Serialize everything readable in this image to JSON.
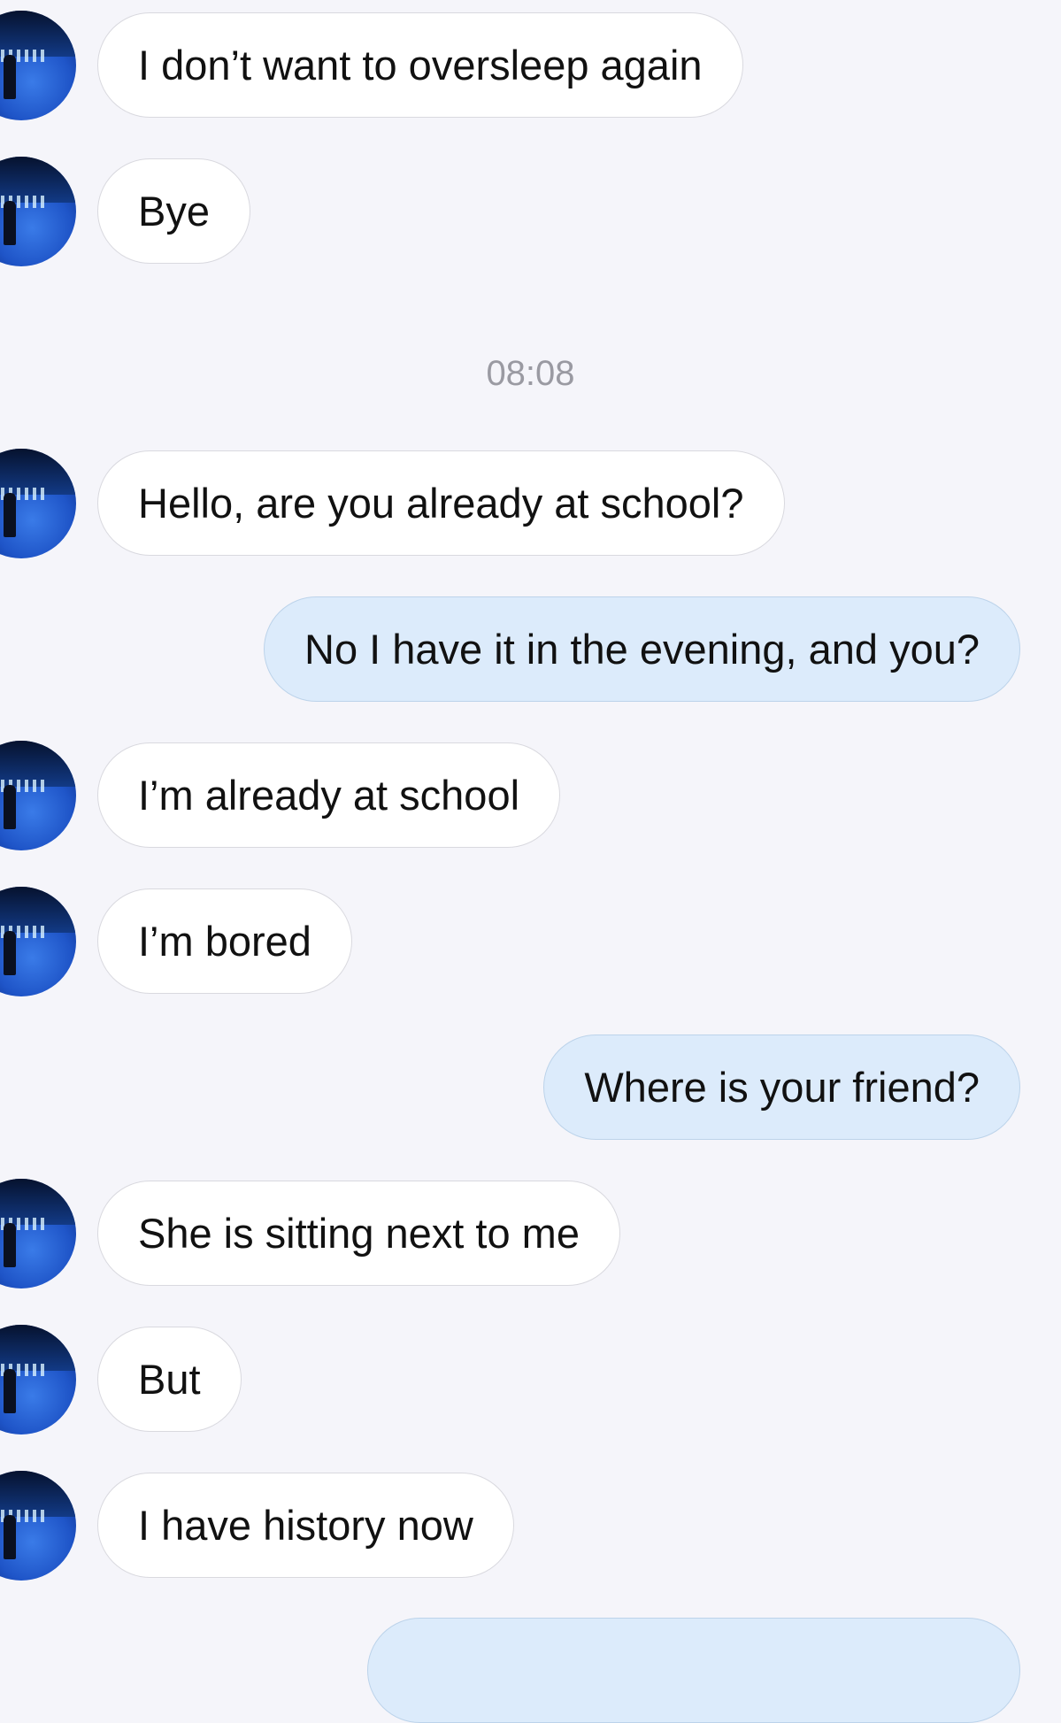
{
  "timestamp": "08:08",
  "messages": [
    {
      "from": "them",
      "text": "I don’t want to oversleep again"
    },
    {
      "from": "them",
      "text": "Bye"
    },
    {
      "from": "them",
      "text": "Hello, are you already at school?"
    },
    {
      "from": "me",
      "text": "No I have it in the evening, and you?"
    },
    {
      "from": "them",
      "text": "I’m already at school"
    },
    {
      "from": "them",
      "text": "I’m bored"
    },
    {
      "from": "me",
      "text": "Where is your friend?"
    },
    {
      "from": "them",
      "text": "She is sitting next to me"
    },
    {
      "from": "them",
      "text": "But"
    },
    {
      "from": "them",
      "text": "I have history now"
    },
    {
      "from": "me",
      "text": ""
    }
  ],
  "colors": {
    "background": "#f5f5fa",
    "incoming_bubble": "#ffffff",
    "outgoing_bubble": "#dcebfb",
    "timestamp": "#9a9aa2"
  }
}
